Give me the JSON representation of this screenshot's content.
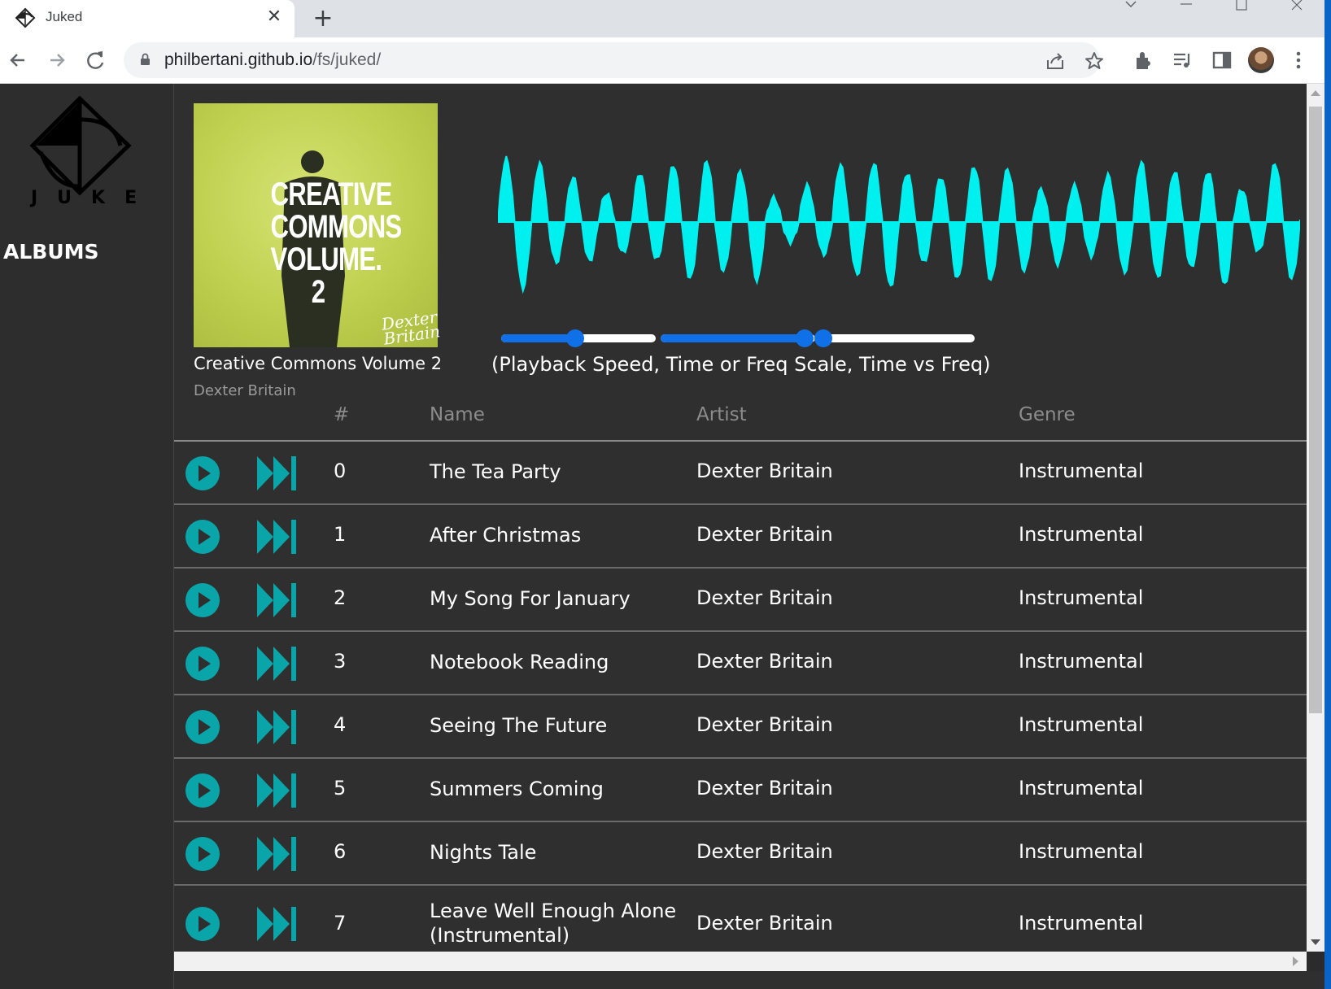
{
  "browser": {
    "tab_title": "Juked",
    "tab_close": "✕",
    "new_tab": "+",
    "url_host": "philbertani.github.io",
    "url_path": "/fs/juked/"
  },
  "sidebar": {
    "logo_text": "JUKE",
    "albums_label": "ALBUMS"
  },
  "album": {
    "art_title": "CREATIVE COMMONS VOLUME. 2",
    "art_signature": "Dexter Britain",
    "name": "Creative Commons Volume 2",
    "artist": "Dexter Britain"
  },
  "controls": {
    "caption": "(Playback Speed, Time or Freq Scale, Time vs Freq)",
    "sliders": [
      {
        "name": "playback-speed",
        "value": 0.48
      },
      {
        "name": "time-or-freq-scale",
        "value": 0.93
      },
      {
        "name": "time-vs-freq",
        "value": 0.02
      }
    ]
  },
  "table": {
    "headers": {
      "num": "#",
      "name": "Name",
      "artist": "Artist",
      "genre": "Genre"
    },
    "rows": [
      {
        "num": "0",
        "name": "The Tea Party",
        "artist": "Dexter Britain",
        "genre": "Instrumental"
      },
      {
        "num": "1",
        "name": "After Christmas",
        "artist": "Dexter Britain",
        "genre": "Instrumental"
      },
      {
        "num": "2",
        "name": "My Song For January",
        "artist": "Dexter Britain",
        "genre": "Instrumental"
      },
      {
        "num": "3",
        "name": "Notebook Reading",
        "artist": "Dexter Britain",
        "genre": "Instrumental"
      },
      {
        "num": "4",
        "name": "Seeing The Future",
        "artist": "Dexter Britain",
        "genre": "Instrumental"
      },
      {
        "num": "5",
        "name": "Summers Coming",
        "artist": "Dexter Britain",
        "genre": "Instrumental"
      },
      {
        "num": "6",
        "name": "Nights Tale",
        "artist": "Dexter Britain",
        "genre": "Instrumental"
      },
      {
        "num": "7",
        "name": "Leave Well Enough Alone (Instrumental)",
        "artist": "Dexter Britain",
        "genre": "Instrumental"
      }
    ]
  },
  "colors": {
    "accent_teal": "#0aa5a8",
    "waveform": "#00f0f0",
    "slider_blue": "#1070e8",
    "background": "#2f2f2f"
  },
  "icons": {
    "play": "play-circle-icon",
    "next": "skip-next-icon"
  }
}
